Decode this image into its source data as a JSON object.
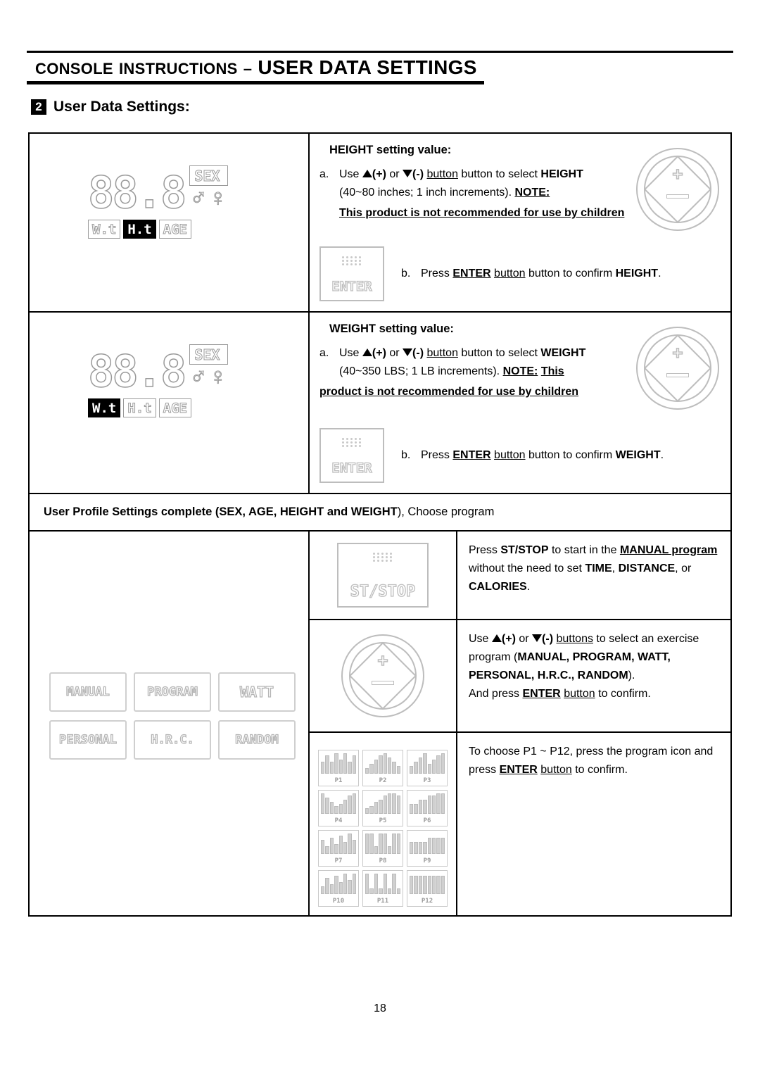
{
  "header": {
    "title_small_1": "Console",
    "title_small_2": "Instructions",
    "title_dash": "–",
    "title_big": "USER DATA SETTINGS",
    "title_full": "CONSOLE INSTRUCTIONS – USER DATA SETTINGS"
  },
  "section": {
    "number": "2",
    "title": "User Data Settings:"
  },
  "height_block": {
    "heading": "HEIGHT setting value:",
    "a_marker": "a.",
    "a_text_1": "Use",
    "a_plus": "(+)",
    "a_or": "or",
    "a_minus": "(-)",
    "a_text_2": "button to select",
    "a_target": "HEIGHT",
    "range_text": "(40~80 inches; 1 inch increments).",
    "note_label": "NOTE:",
    "warning": "This product is not recommended for use by children",
    "b_marker": "b.",
    "b_text_1": "Press",
    "b_enter": "ENTER",
    "b_text_2": "button to confirm",
    "b_target": "HEIGHT",
    "b_period": ".",
    "lcd": {
      "digits": "88.8",
      "sex_label": "SEX",
      "wt_label": "W.t",
      "ht_label": "H.t",
      "age_label": "AGE",
      "active_label": "H.t"
    }
  },
  "weight_block": {
    "heading": "WEIGHT setting value:",
    "a_marker": "a.",
    "a_text_1": "Use",
    "a_plus": "(+)",
    "a_or": "or",
    "a_minus": "(-)",
    "a_text_2": "button to select",
    "a_target": "WEIGHT",
    "range_text": "(40~350 LBS; 1 LB increments).",
    "note_label": "NOTE:",
    "warning": "This product is not recommended for use by children",
    "b_marker": "b.",
    "b_text_1": "Press",
    "b_enter": "ENTER",
    "b_text_2": "button to confirm",
    "b_target": "WEIGHT",
    "b_period": ".",
    "lcd": {
      "digits": "88.8",
      "sex_label": "SEX",
      "wt_label": "W.t",
      "ht_label": "H.t",
      "age_label": "AGE",
      "active_label": "W.t"
    }
  },
  "profile_note": {
    "lead": "User Profile Settings complete (SEX, AGE, HEIGHT",
    "and": "and",
    "weight": "WEIGHT",
    "tail": "), Choose program",
    "full": "User Profile Settings complete (SEX, AGE, HEIGHT and WEIGHT), Choose program"
  },
  "manual_block": {
    "text_1": "Press",
    "stst": "ST/STOP",
    "text_2": "to start in the",
    "manual_program": "MANUAL program",
    "text_3": "without the need to set",
    "time": "TIME",
    "comma": ",",
    "distance": "DISTANCE",
    "or": ", or",
    "calories": "CALORIES",
    "period": ".",
    "button_label": "ST/STOP"
  },
  "select_block": {
    "text_1": "Use",
    "plus": "(+)",
    "or": "or",
    "minus": "(-)",
    "text_2": "buttons to select an exercise program (",
    "programs": "MANUAL, PROGRAM, WATT, PERSONAL, H.R.C., RANDOM",
    "text_3": ").",
    "text_4": "And press",
    "enter": "ENTER",
    "text_5": "button to confirm."
  },
  "pselect_block": {
    "text_1": "To choose P1 ~ P12, press the program icon and press",
    "enter": "ENTER",
    "text_2": "button to confirm."
  },
  "program_keys": [
    "MANUAL",
    "PROGRAM",
    "WATT",
    "PERSONAL",
    "H.R.C.",
    "RANDOM"
  ],
  "program_icons": [
    {
      "label": "P1",
      "bars": [
        5,
        8,
        5,
        9,
        6,
        9,
        5,
        8
      ]
    },
    {
      "label": "P2",
      "bars": [
        2,
        4,
        6,
        8,
        9,
        7,
        5,
        3
      ]
    },
    {
      "label": "P3",
      "bars": [
        3,
        5,
        7,
        9,
        4,
        6,
        8,
        9
      ]
    },
    {
      "label": "P4",
      "bars": [
        9,
        7,
        5,
        3,
        4,
        6,
        8,
        9
      ]
    },
    {
      "label": "P5",
      "bars": [
        2,
        3,
        5,
        6,
        8,
        9,
        9,
        8
      ]
    },
    {
      "label": "P6",
      "bars": [
        4,
        4,
        6,
        6,
        8,
        8,
        9,
        9
      ]
    },
    {
      "label": "P7",
      "bars": [
        6,
        3,
        7,
        4,
        8,
        5,
        9,
        6
      ]
    },
    {
      "label": "P8",
      "bars": [
        9,
        9,
        3,
        9,
        9,
        3,
        9,
        9
      ]
    },
    {
      "label": "P9",
      "bars": [
        5,
        5,
        5,
        5,
        7,
        7,
        7,
        7
      ]
    },
    {
      "label": "P10",
      "bars": [
        3,
        7,
        4,
        8,
        5,
        9,
        6,
        9
      ]
    },
    {
      "label": "P11",
      "bars": [
        9,
        2,
        9,
        2,
        9,
        2,
        9,
        2
      ]
    },
    {
      "label": "P12",
      "bars": [
        8,
        8,
        8,
        8,
        8,
        8,
        8,
        8
      ]
    }
  ],
  "footer": {
    "page_number": "18"
  }
}
